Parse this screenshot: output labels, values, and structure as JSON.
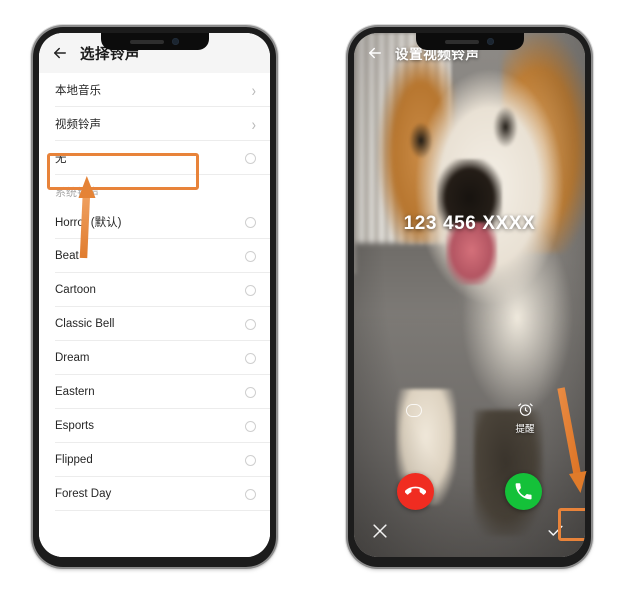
{
  "accent": {
    "highlight_orange": "#e8833a",
    "decline_red": "#f02c21",
    "accept_green": "#14c139"
  },
  "left_phone": {
    "screen_name": "select-ringtone",
    "header": {
      "back_icon": "back-arrow-icon",
      "title": "选择铃声"
    },
    "rows": [
      {
        "label": "本地音乐",
        "type": "nav",
        "trailing": "chevron-right-icon"
      },
      {
        "label": "视频铃声",
        "type": "nav",
        "trailing": "chevron-right-icon",
        "highlighted": true
      },
      {
        "label": "无",
        "type": "radio",
        "trailing": "radio-unselected"
      },
      {
        "label": "系统铃声",
        "type": "section",
        "trailing": ""
      },
      {
        "label": "Horror (默认)",
        "type": "radio",
        "trailing": "radio-unselected"
      },
      {
        "label": "Beat",
        "type": "radio",
        "trailing": "radio-unselected"
      },
      {
        "label": "Cartoon",
        "type": "radio",
        "trailing": "radio-unselected"
      },
      {
        "label": "Classic Bell",
        "type": "radio",
        "trailing": "radio-unselected"
      },
      {
        "label": "Dream",
        "type": "radio",
        "trailing": "radio-unselected"
      },
      {
        "label": "Eastern",
        "type": "radio",
        "trailing": "radio-unselected"
      },
      {
        "label": "Esports",
        "type": "radio",
        "trailing": "radio-unselected"
      },
      {
        "label": "Flipped",
        "type": "radio",
        "trailing": "radio-unselected"
      },
      {
        "label": "Forest Day",
        "type": "radio",
        "trailing": "radio-unselected"
      }
    ],
    "annotation": {
      "arrow_direction": "up",
      "points_to": "视频铃声"
    }
  },
  "right_phone": {
    "screen_name": "set-video-ringtone-preview",
    "header": {
      "back_icon": "back-arrow-icon",
      "title": "设置视频铃声"
    },
    "caller_number": "123 456 XXXX",
    "quick_actions": [
      {
        "name": "message-icon",
        "label": ""
      },
      {
        "name": "alarm-clock-icon",
        "label": "提醒"
      }
    ],
    "call_buttons": [
      {
        "name": "decline-call-button",
        "icon": "phone-down-icon"
      },
      {
        "name": "accept-call-button",
        "icon": "phone-icon"
      }
    ],
    "bottom_bar": {
      "cancel_icon": "close-x-icon",
      "confirm_icon": "check-icon",
      "confirm_highlighted": true
    },
    "annotation": {
      "arrow_direction": "down-right",
      "points_to": "confirm-check-button"
    }
  }
}
